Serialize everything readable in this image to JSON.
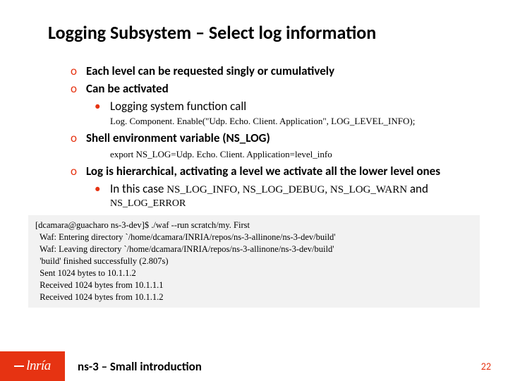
{
  "title": "Logging Subsystem – Select log information",
  "bullets": {
    "b1": "Each level can be requested singly or cumulatively",
    "b2": "Can be activated",
    "b2a": "Logging system function call",
    "code1": "Log. Component. Enable(\"Udp. Echo. Client. Application\",  LOG_LEVEL_INFO);",
    "b3": "Shell environment variable (NS_LOG)",
    "code2": "export NS_LOG=Udp. Echo. Client. Application=level_info",
    "b4": "Log is hierarchical, activating a level we activate all the lower level ones",
    "b4a_pre": "In this case ",
    "b4a_code": "NS_LOG_INFO, NS_LOG_DEBUG, NS_LOG_WARN",
    "b4a_post": " and",
    "b4a_line2": "NS_LOG_ERROR"
  },
  "terminal": {
    "l1": "[dcamara@guacharo ns-3-dev]$ ./waf --run scratch/my. First",
    "l2": "  Waf: Entering directory `/home/dcamara/INRIA/repos/ns-3-allinone/ns-3-dev/build'",
    "l3": "  Waf: Leaving directory `/home/dcamara/INRIA/repos/ns-3-allinone/ns-3-dev/build'",
    "l4": "  'build' finished successfully (2.807s)",
    "l5": "  Sent 1024 bytes to 10.1.1.2",
    "l6": "  Received 1024 bytes from 10.1.1.1",
    "l7": "  Received 1024 bytes from 10.1.1.2"
  },
  "footer": {
    "logo": "lnría",
    "title": "ns-3 – Small introduction",
    "page": "22"
  }
}
